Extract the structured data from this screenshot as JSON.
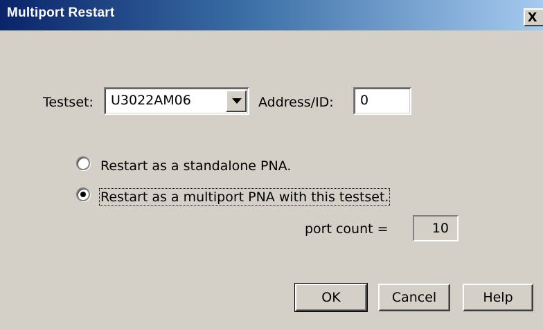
{
  "window": {
    "title": "Multiport Restart",
    "close_glyph": "x",
    "close_icon": "close-icon"
  },
  "testset": {
    "label": "Testset:",
    "selected": "U3022AM06",
    "dropdown_icon": "chevron-down-icon"
  },
  "address": {
    "label": "Address/ID:",
    "value": "0"
  },
  "options": {
    "standalone_label": "Restart as a standalone PNA.",
    "standalone_selected": false,
    "multiport_label": "Restart as a multiport PNA with this testset.",
    "multiport_selected": true
  },
  "port_count": {
    "label": "port count =",
    "value": "10"
  },
  "buttons": {
    "ok": "OK",
    "cancel": "Cancel",
    "help": "Help"
  },
  "colors": {
    "titlebar_start": "#0a246a",
    "titlebar_end": "#a6caf0",
    "face": "#d4d0c8"
  }
}
